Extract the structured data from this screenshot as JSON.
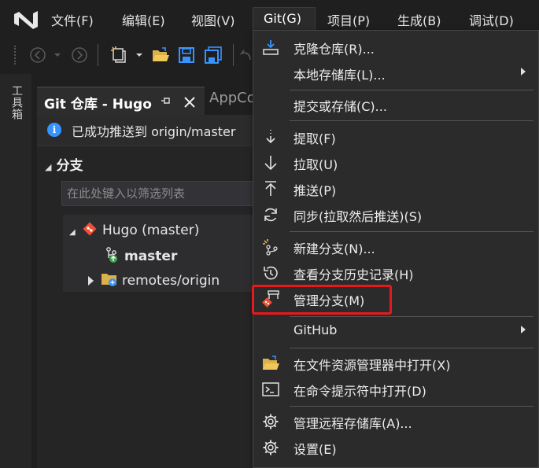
{
  "menubar": {
    "items": [
      "文件(F)",
      "编辑(E)",
      "视图(V)",
      "Git(G)",
      "项目(P)",
      "生成(B)",
      "调试(D)"
    ]
  },
  "toolbox": {
    "label": "工具箱"
  },
  "tabs": {
    "active": {
      "label": "Git 仓库 - Hugo"
    },
    "inactive": {
      "label": "AppCo"
    }
  },
  "info": {
    "text": "已成功推送到 origin/master"
  },
  "branches": {
    "header": "分支",
    "filter_placeholder": "在此处键入以筛选列表",
    "repo": "Hugo (master)",
    "current": "master",
    "remotes": "remotes/origin"
  },
  "git_menu": {
    "items": [
      {
        "label": "克隆仓库(R)...",
        "icon": "clone-icon"
      },
      {
        "label": "本地存储库(L)...",
        "icon": "none",
        "submenu": true
      },
      {
        "label": "提交或存储(C)...",
        "icon": "none"
      },
      {
        "label": "提取(F)",
        "icon": "fetch-icon"
      },
      {
        "label": "拉取(U)",
        "icon": "pull-icon"
      },
      {
        "label": "推送(P)",
        "icon": "push-icon"
      },
      {
        "label": "同步(拉取然后推送)(S)",
        "icon": "sync-icon"
      },
      {
        "label": "新建分支(N)...",
        "icon": "new-branch-icon"
      },
      {
        "label": "查看分支历史记录(H)",
        "icon": "history-icon"
      },
      {
        "label": "管理分支(M)",
        "icon": "manage-branches-icon",
        "highlighted": true
      },
      {
        "label": "GitHub",
        "icon": "none",
        "submenu": true
      },
      {
        "label": "在文件资源管理器中打开(X)",
        "icon": "open-folder-icon"
      },
      {
        "label": "在命令提示符中打开(D)",
        "icon": "terminal-icon"
      },
      {
        "label": "管理远程存储库(A)...",
        "icon": "gear-icon"
      },
      {
        "label": "设置(E)",
        "icon": "gear-icon"
      }
    ]
  },
  "colors": {
    "accent": "#3794ff",
    "highlight_border": "#e8191d",
    "git_red": "#f05133"
  }
}
